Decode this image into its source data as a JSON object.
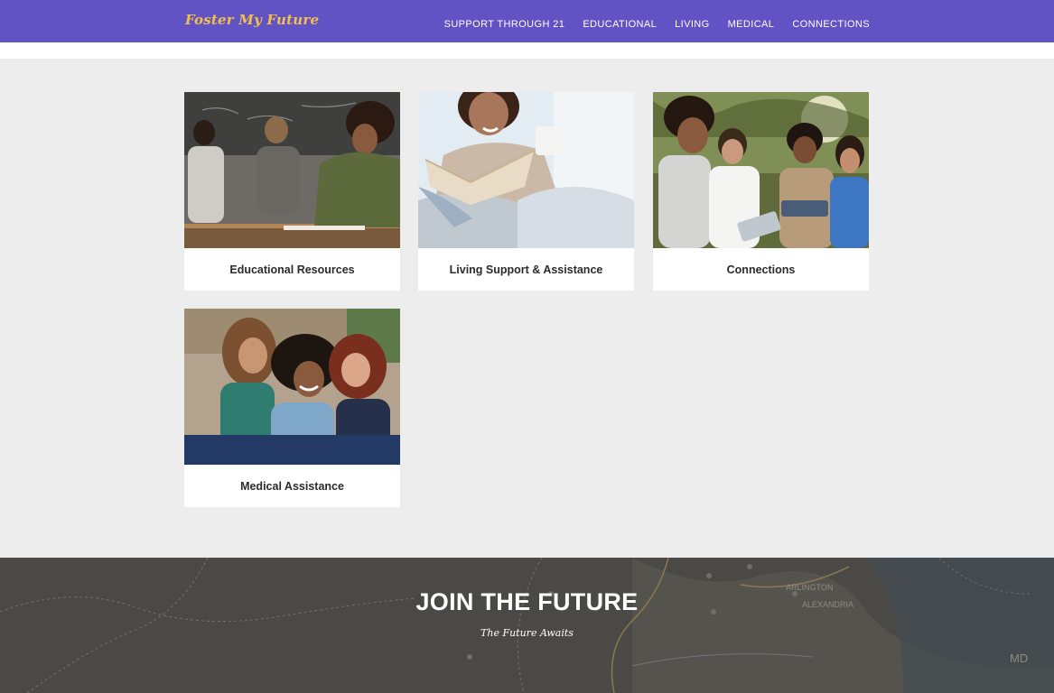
{
  "nav": {
    "brand": "Foster My Future",
    "links": [
      "SUPPORT THROUGH 21",
      "EDUCATIONAL",
      "LIVING",
      "MEDICAL",
      "CONNECTIONS"
    ]
  },
  "cards": [
    {
      "title": "Educational Resources",
      "image": "classroom-students-photo"
    },
    {
      "title": "Living Support & Assistance",
      "image": "reading-book-photo"
    },
    {
      "title": "Connections",
      "image": "friends-with-tablet-photo"
    },
    {
      "title": "Medical Assistance",
      "image": "three-friends-hugging-photo"
    }
  ],
  "join": {
    "title": "JOIN THE FUTURE",
    "subtitle": "The Future Awaits",
    "map_labels": [
      "ARLINGTON",
      "ALEXANDRIA",
      "MD"
    ]
  },
  "colors": {
    "nav_bg": "#6153c3",
    "brand": "#f5c04a",
    "page_bg": "#ededed",
    "footer_bg": "#4b4945"
  }
}
